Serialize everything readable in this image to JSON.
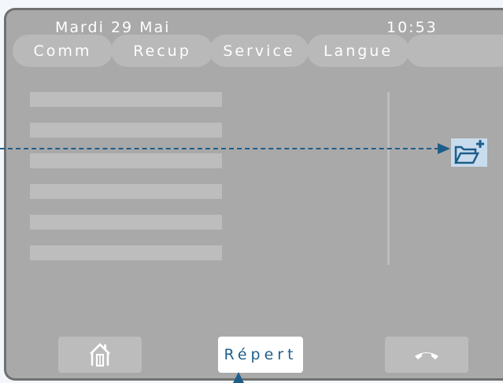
{
  "status": {
    "date": "Mardi 29 Mai",
    "time": "10:53"
  },
  "tabs": [
    {
      "label": "Comm"
    },
    {
      "label": "Recup"
    },
    {
      "label": "Service"
    },
    {
      "label": "Langue"
    },
    {
      "label": ""
    }
  ],
  "softkeys": {
    "home_icon": "home-icon",
    "center_label": "Répert",
    "hangup_icon": "hang-up-phone-icon"
  },
  "callout": {
    "icon": "add-folder-icon"
  },
  "colors": {
    "screen": "#a9a9a9",
    "accent": "#1d5d8a",
    "callout_bg": "#c9dcee"
  }
}
